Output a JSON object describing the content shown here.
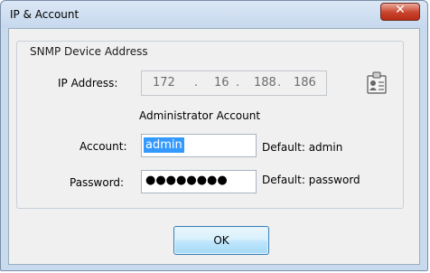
{
  "window": {
    "title": "IP & Account",
    "close_glyph": "✕"
  },
  "group": {
    "legend": "SNMP Device Address"
  },
  "ip": {
    "label": "IP Address:",
    "octets": [
      "172",
      "16",
      "188",
      "186"
    ],
    "separator": "."
  },
  "admin": {
    "heading": "Administrator Account",
    "account_label": "Account:",
    "account_value": "admin",
    "account_default": "Default: admin",
    "password_label": "Password:",
    "password_mask": "●●●●●●●●",
    "password_default": "Default: password"
  },
  "buttons": {
    "ok": "OK"
  },
  "icons": {
    "close": "close-icon",
    "card": "id-card-icon"
  },
  "colors": {
    "selection": "#3399ff",
    "close_red": "#c8432b"
  }
}
